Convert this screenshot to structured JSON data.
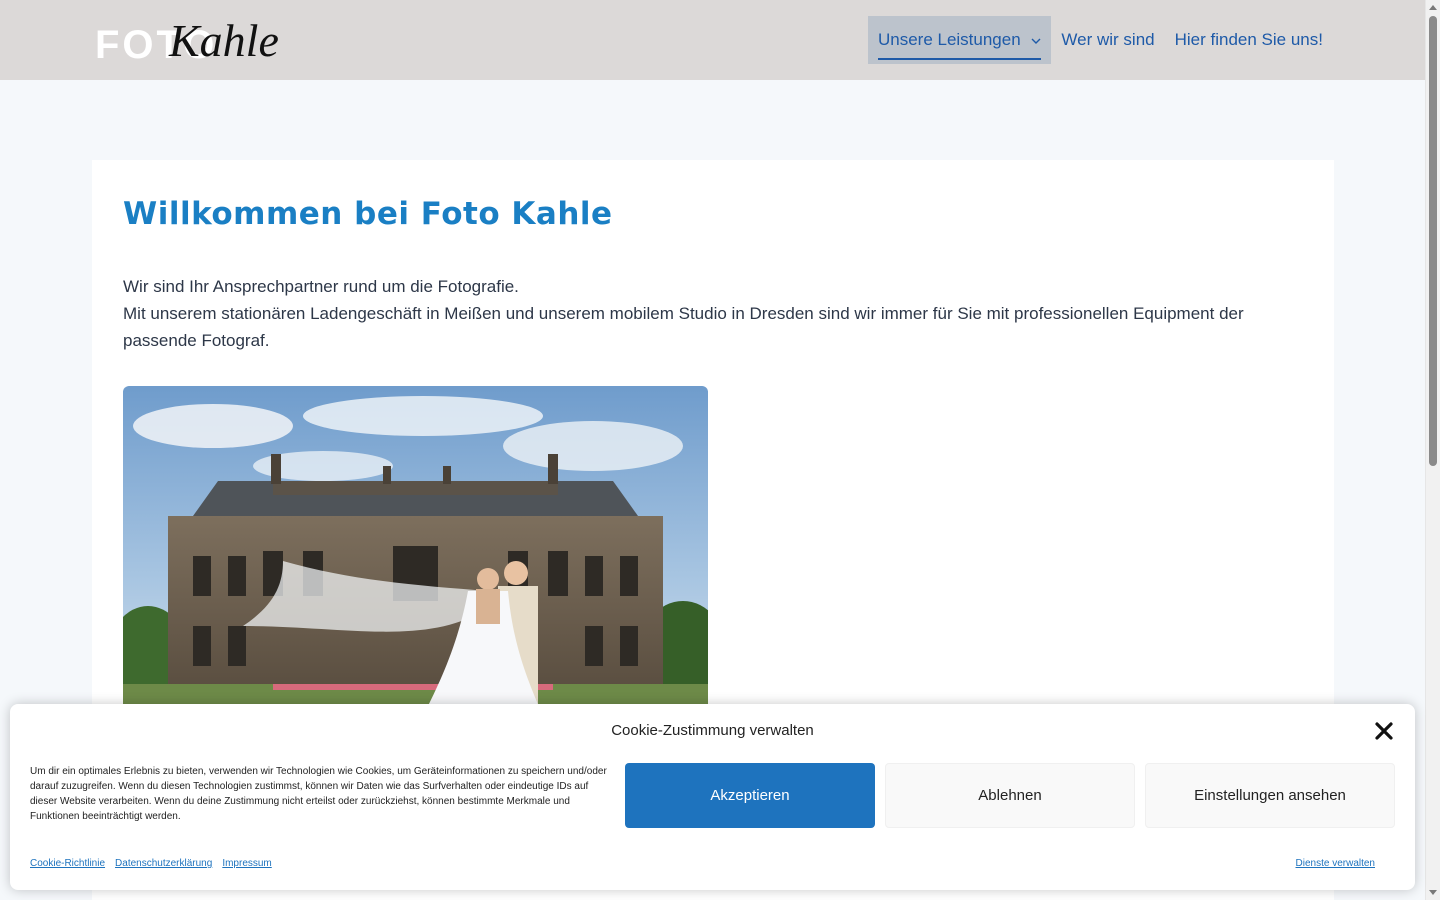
{
  "header": {
    "logo": {
      "part1": "FOTO",
      "part2": "Kahle"
    },
    "nav": [
      {
        "label": "Unsere Leistungen",
        "active": true,
        "icon": "chevron-down-icon"
      },
      {
        "label": "Wer wir sind",
        "active": false
      },
      {
        "label": "Hier finden Sie uns!",
        "active": false
      }
    ]
  },
  "main": {
    "title": "Willkommen bei Foto Kahle",
    "intro_line1": "Wir sind Ihr Ansprechpartner rund um die Fotografie.",
    "intro_line2": "Mit unserem stationären Ladengeschäft in Meißen und unserem mobilem Studio in Dresden sind wir immer für Sie mit professionellen Equipment der passende Fotograf.",
    "hero_image": "wedding-photo"
  },
  "cookie": {
    "title": "Cookie-Zustimmung verwalten",
    "text": "Um dir ein optimales Erlebnis zu bieten, verwenden wir Technologien wie Cookies, um Geräteinformationen zu speichern und/oder darauf zuzugreifen. Wenn du diesen Technologien zustimmst, können wir Daten wie das Surfverhalten oder eindeutige IDs auf dieser Website verarbeiten. Wenn du deine Zustimmung nicht erteilst oder zurückziehst, können bestimmte Merkmale und Funktionen beeinträchtigt werden.",
    "accept_label": "Akzeptieren",
    "deny_label": "Ablehnen",
    "settings_label": "Einstellungen ansehen",
    "links": [
      "Cookie-Richtlinie",
      "Datenschutzerklärung",
      "Impressum"
    ],
    "manage_label": "Dienste verwalten"
  },
  "colors": {
    "accent": "#1e73be",
    "title": "#1a7fc4",
    "header_bg": "#dcd9d8"
  }
}
